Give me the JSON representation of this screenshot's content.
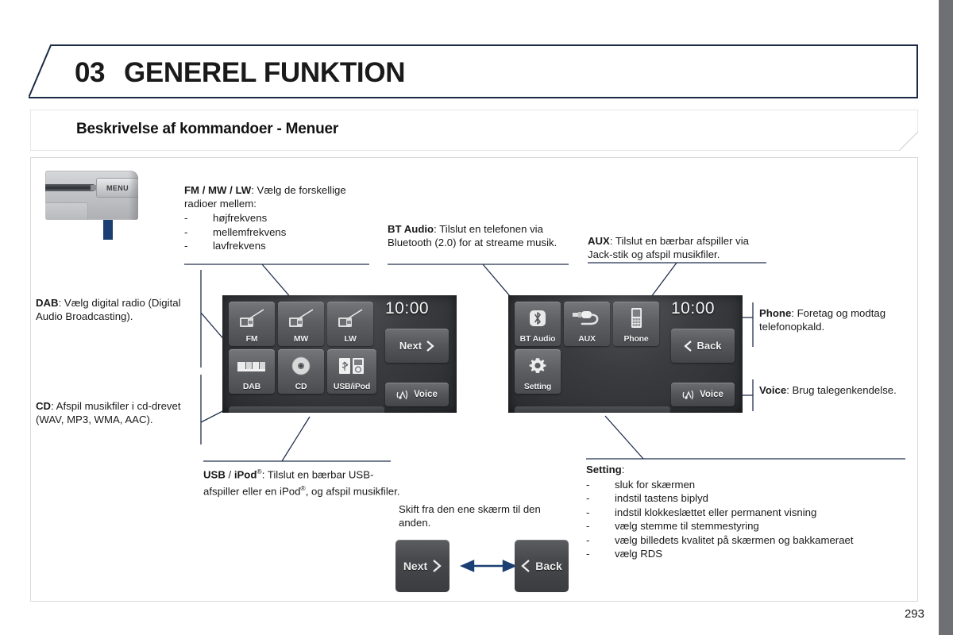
{
  "header": {
    "chapter_number": "03",
    "chapter_title": "GENEREL FUNKTION",
    "section_title": "Beskrivelse af kommandoer - Menuer"
  },
  "device": {
    "button_label": "MENU",
    "arrow_icon": "up-arrow-icon"
  },
  "notes": {
    "radio": {
      "bold": "FM / MW / LW",
      "text": ": Vælg de forskellige radioer mellem:",
      "items": [
        "højfrekvens",
        "mellemfrekvens",
        "lavfrekvens"
      ]
    },
    "bt_audio": {
      "bold": "BT Audio",
      "text": ": Tilslut en telefonen via Bluetooth (2.0) for at streame musik."
    },
    "aux": {
      "bold": "AUX",
      "text": ": Tilslut en bærbar afspiller via Jack-stik og afspil musikfiler."
    },
    "dab": {
      "bold": "DAB",
      "text": ": Vælg digital radio (Digital Audio Broadcasting)."
    },
    "cd": {
      "bold": "CD",
      "text": ": Afspil musikfiler i cd-drevet (WAV, MP3, WMA, AAC)."
    },
    "usb": {
      "bold_a": "USB",
      "sep": " / ",
      "bold_b": "iPod",
      "sup1": "®",
      "text_a": ": Tilslut en bærbar USB-afspiller eller en iPod",
      "sup2": "®",
      "text_b": ", og afspil musikfiler."
    },
    "phone": {
      "bold": "Phone",
      "text": ": Foretag og modtag telefonopkald."
    },
    "voice": {
      "bold": "Voice",
      "text": ": Brug talegenkendelse."
    },
    "setting": {
      "bold": "Setting",
      "text": ":",
      "items": [
        "sluk for skærmen",
        "indstil tastens biplyd",
        "indstil klokkeslættet eller permanent visning",
        "vælg stemme til stemmestyring",
        "vælg billedets kvalitet på skærmen og bakkameraet",
        "vælg RDS"
      ]
    },
    "switch_screens": "Skift fra den ene skærm til den anden."
  },
  "screen_left": {
    "clock": "10:00",
    "tiles": [
      {
        "label": "FM",
        "icon": "radio-fm-icon"
      },
      {
        "label": "MW",
        "icon": "radio-mw-icon"
      },
      {
        "label": "LW",
        "icon": "radio-lw-icon"
      },
      {
        "label": "DAB",
        "icon": "dab-icon"
      },
      {
        "label": "CD",
        "icon": "cd-disc-icon"
      },
      {
        "label": "USB/iPod",
        "icon": "usb-ipod-icon"
      }
    ],
    "next_label": "Next",
    "next_icon": "chevron-right-icon",
    "voice_label": "Voice",
    "voice_icon": "voice-wave-icon"
  },
  "screen_right": {
    "clock": "10:00",
    "tiles": [
      {
        "label": "BT Audio",
        "icon": "bluetooth-icon"
      },
      {
        "label": "AUX",
        "icon": "jack-plug-icon"
      },
      {
        "label": "Phone",
        "icon": "mobile-phone-icon"
      },
      {
        "label": "Setting",
        "icon": "gear-icon"
      }
    ],
    "back_label": "Back",
    "back_icon": "chevron-left-icon",
    "voice_label": "Voice",
    "voice_icon": "voice-wave-icon"
  },
  "bottom_buttons": {
    "next_label": "Next",
    "next_icon": "chevron-right-icon",
    "back_label": "Back",
    "back_icon": "chevron-left-icon",
    "swap_icon": "double-arrow-icon"
  },
  "footer": {
    "page_number": "293"
  },
  "colors": {
    "accent": "#1b3f72",
    "header_border": "#1b2a45",
    "screen_dark": "#2a2c2f",
    "text": "#1a1a1a"
  }
}
